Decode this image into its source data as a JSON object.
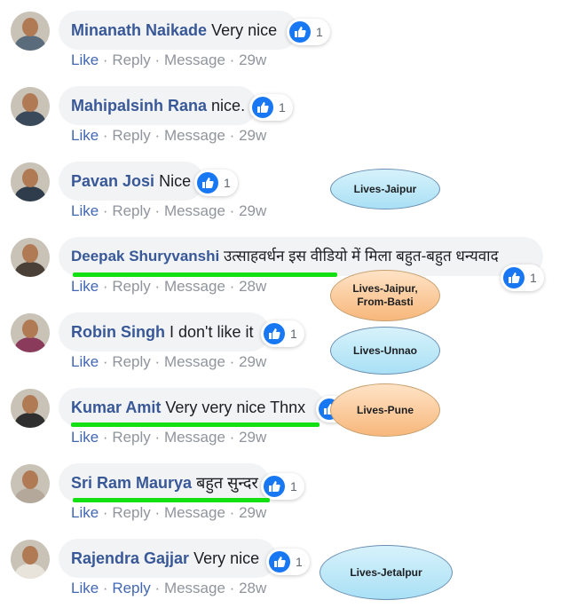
{
  "comments": [
    {
      "name": "Minanath Naikade",
      "text": "Very nice",
      "reactions": "1",
      "like": "Like",
      "reply": "Reply",
      "message": "Message",
      "time": "29w"
    },
    {
      "name": "Mahipalsinh Rana",
      "text": "nice.",
      "reactions": "1",
      "like": "Like",
      "reply": "Reply",
      "message": "Message",
      "time": "29w"
    },
    {
      "name": "Pavan Josi",
      "text": "Nice",
      "reactions": "1",
      "like": "Like",
      "reply": "Reply",
      "message": "Message",
      "time": "29w"
    },
    {
      "name": "Deepak Shuryvanshi",
      "text": "उत्साहवर्धन इस वीडियो में मिला बहुत-बहुत धन्यवाद",
      "reactions": "1",
      "like": "Like",
      "reply": "Reply",
      "message": "Message",
      "time": "28w"
    },
    {
      "name": "Robin Singh",
      "text": "I don't like it",
      "reactions": "1",
      "like": "Like",
      "reply": "Reply",
      "message": "Message",
      "time": "29w"
    },
    {
      "name": "Kumar Amit",
      "text": "Very very nice Thnx",
      "reactions": "",
      "like": "Like",
      "reply": "Reply",
      "message": "Message",
      "time": "29w"
    },
    {
      "name": "Sri Ram Maurya",
      "text": "बहुत सुन्दर",
      "reactions": "1",
      "like": "Like",
      "reply": "Reply",
      "message": "Message",
      "time": "29w"
    },
    {
      "name": "Rajendra Gajjar",
      "text": "Very nice",
      "reactions": "1",
      "like": "Like",
      "reply": "Reply",
      "message": "Message",
      "time": "28w"
    }
  ],
  "annotations": {
    "a1": "Lives-Jaipur",
    "a2_line1": "Lives-Jaipur,",
    "a2_line2": "From-Basti",
    "a3": "Lives-Unnao",
    "a4": "Lives-Pune",
    "a5": "Lives-Jetalpur"
  },
  "separator": "·",
  "colors": {
    "name": "#385898",
    "link": "#4267b2",
    "like_icon": "#1877f2",
    "highlight": "#12e012"
  }
}
